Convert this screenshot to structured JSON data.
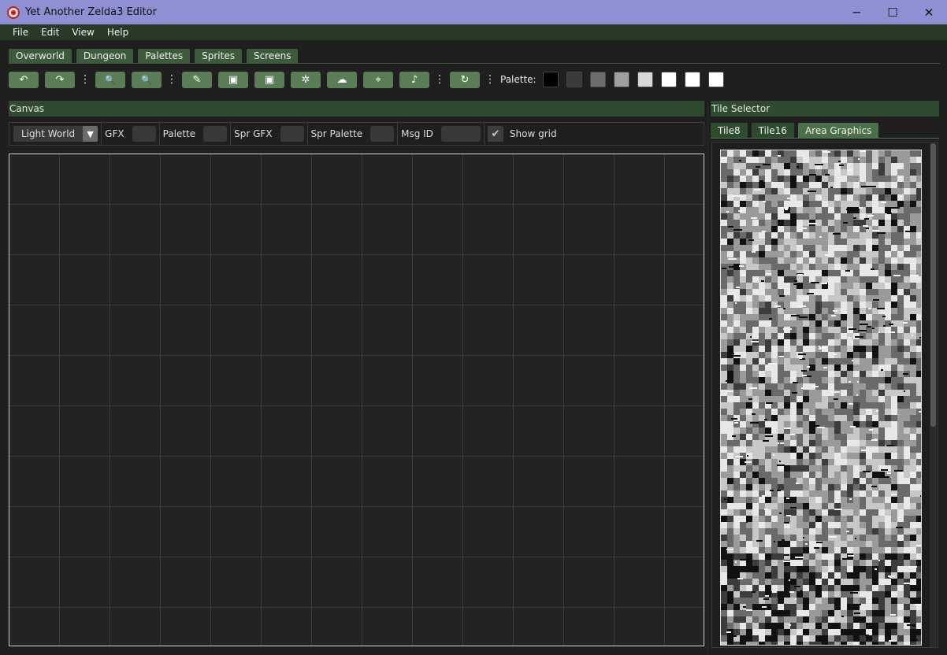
{
  "window": {
    "title": "Yet Another Zelda3 Editor",
    "controls": {
      "minimize": "─",
      "maximize": "☐",
      "close": "✕"
    }
  },
  "menu": [
    "File",
    "Edit",
    "View",
    "Help"
  ],
  "editor_tabs": [
    "Overworld",
    "Dungeon",
    "Palettes",
    "Sprites",
    "Screens"
  ],
  "toolbar": {
    "buttons": [
      {
        "icon": "undo-icon",
        "glyph": "↶"
      },
      {
        "icon": "redo-icon",
        "glyph": "↷"
      },
      {
        "icon": "zoom-out-icon",
        "glyph": "🔍"
      },
      {
        "icon": "zoom-in-icon",
        "glyph": "🔍"
      },
      {
        "icon": "draw-icon",
        "glyph": "✎"
      },
      {
        "icon": "entrance-icon",
        "glyph": "▣"
      },
      {
        "icon": "exit-icon",
        "glyph": "▣"
      },
      {
        "icon": "item-icon",
        "glyph": "✲"
      },
      {
        "icon": "sprite-icon",
        "glyph": "☁"
      },
      {
        "icon": "transport-icon",
        "glyph": "⌖"
      },
      {
        "icon": "music-icon",
        "glyph": "♪"
      },
      {
        "icon": "refresh-icon",
        "glyph": "↻"
      }
    ],
    "more_glyph": "⋮",
    "palette_label": "Palette:",
    "palette_colors": [
      "#000000",
      "#3a3a3a",
      "#6d6d6d",
      "#a0a0a0",
      "#d8d8d8",
      "#ffffff",
      "#ffffff",
      "#ffffff"
    ]
  },
  "canvas_panel": {
    "header": "Canvas",
    "world_select": "Light World",
    "dropdown_glyph": "▼",
    "labels": {
      "gfx": "GFX",
      "palette": "Palette",
      "spr_gfx": "Spr GFX",
      "spr_palette": "Spr Palette",
      "msg_id": "Msg ID",
      "show_grid": "Show grid"
    },
    "show_grid_checked": true,
    "check_glyph": "✔"
  },
  "tile_selector": {
    "header": "Tile Selector",
    "tabs": [
      "Tile8",
      "Tile16",
      "Area Graphics"
    ],
    "active_tab": "Area Graphics"
  }
}
